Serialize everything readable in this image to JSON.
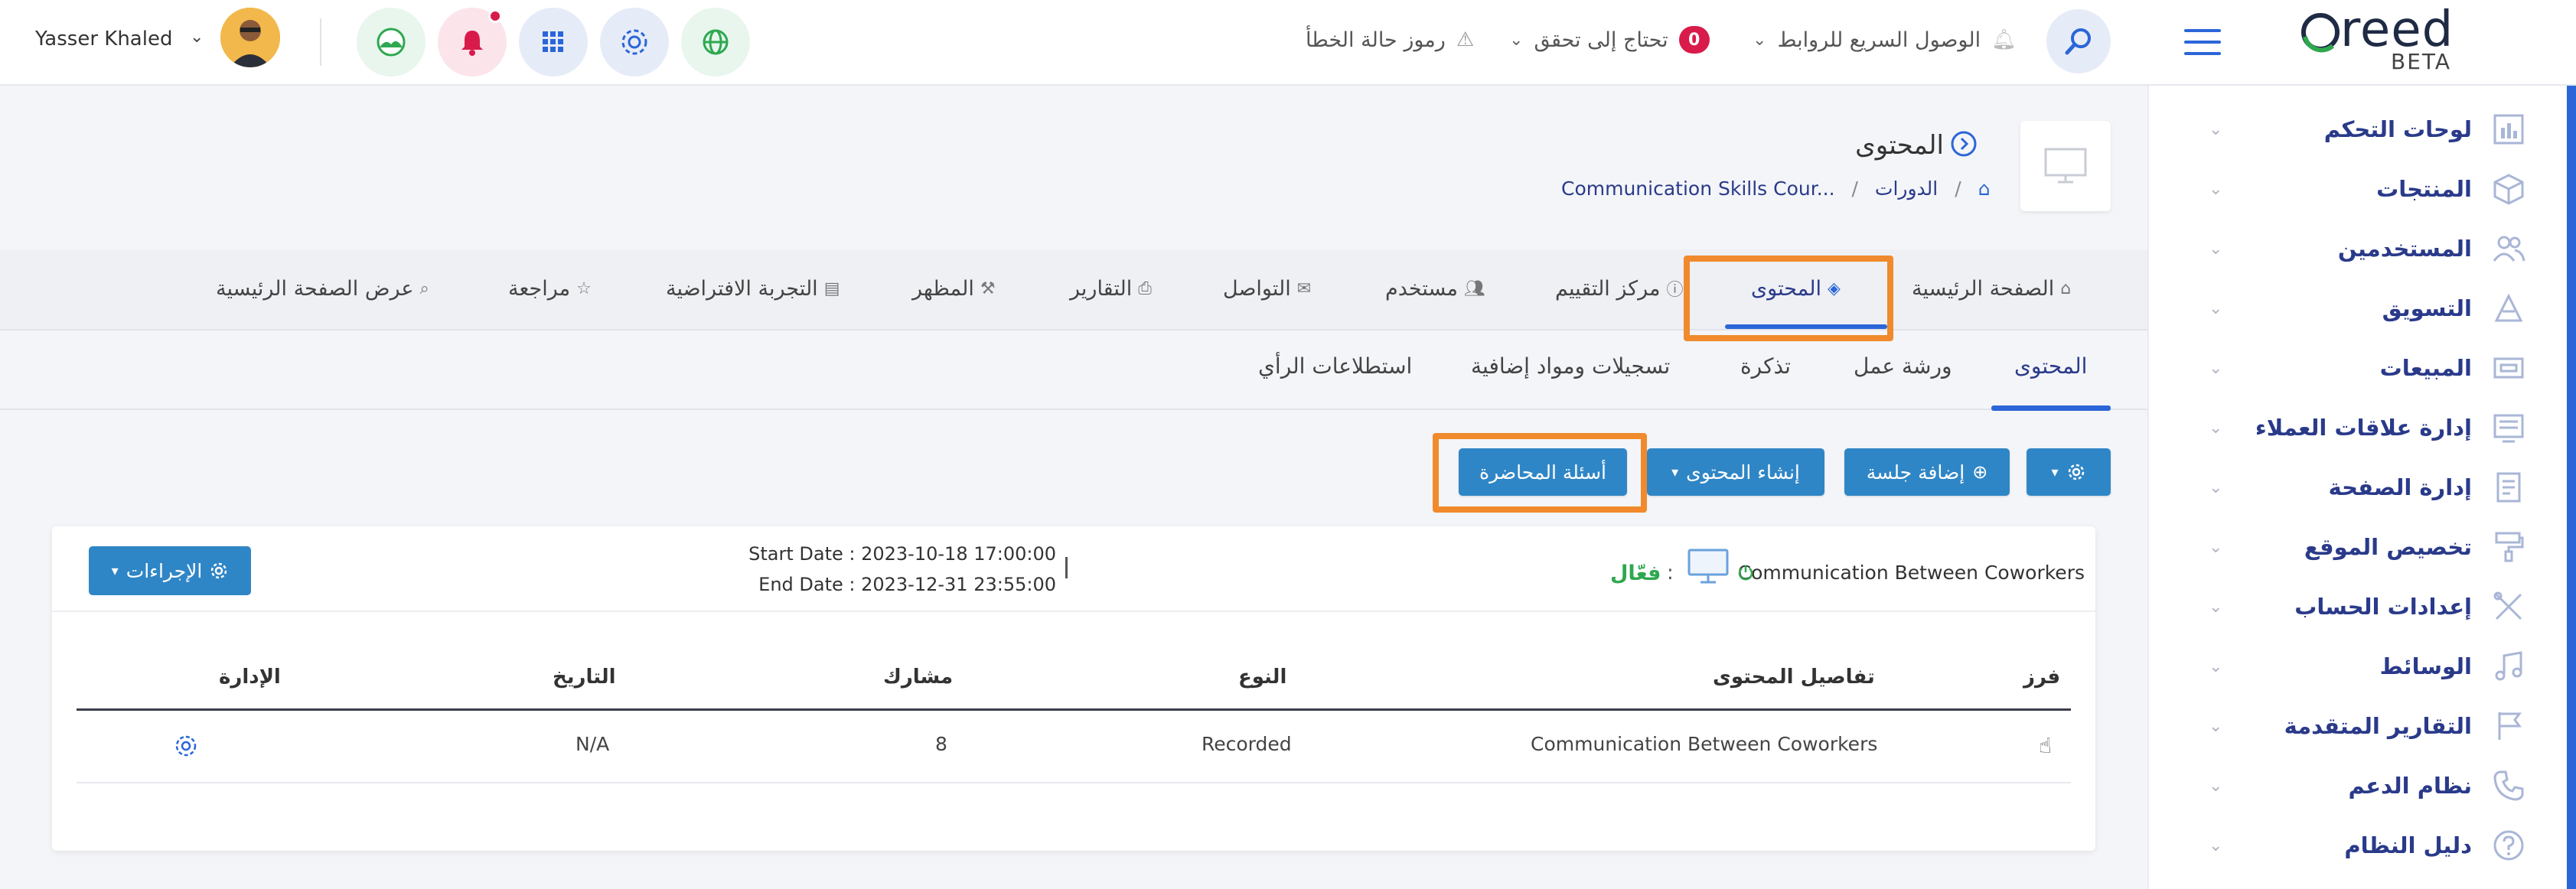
{
  "topbar": {
    "logo_text": "reed",
    "logo_sub": "BETA",
    "quick_links_label": "الوصول السريع للروابط",
    "needs_check_label": "تحتاج إلى تحقق",
    "needs_check_count": "0",
    "error_codes_label": "رموز حالة الخطأ",
    "user_name": "Yasser Khaled"
  },
  "sidebar": {
    "items": [
      {
        "label": "لوحات التحكم",
        "icon": "dashboard-icon"
      },
      {
        "label": "المنتجات",
        "icon": "box-icon"
      },
      {
        "label": "المستخدمين",
        "icon": "users-icon"
      },
      {
        "label": "التسويق",
        "icon": "marketing-icon"
      },
      {
        "label": "المبيعات",
        "icon": "sales-icon"
      },
      {
        "label": "إدارة علاقات العملاء",
        "icon": "crm-icon"
      },
      {
        "label": "إدارة الصفحة",
        "icon": "page-icon"
      },
      {
        "label": "تخصيص الموقع",
        "icon": "paint-roller-icon"
      },
      {
        "label": "إعدادات الحساب",
        "icon": "tools-icon"
      },
      {
        "label": "الوسائط",
        "icon": "music-icon"
      },
      {
        "label": "التقارير المتقدمة",
        "icon": "flag-icon"
      },
      {
        "label": "نظام الدعم",
        "icon": "phone-icon"
      },
      {
        "label": "دليل النظام",
        "icon": "help-icon"
      }
    ]
  },
  "page": {
    "title": "المحتوى",
    "breadcrumb_courses": "الدورات",
    "breadcrumb_current": "Communication Skills Cour..."
  },
  "tabs1": [
    {
      "label": "الصفحة الرئيسية"
    },
    {
      "label": "المحتوى"
    },
    {
      "label": "مركز التقييم"
    },
    {
      "label": "مستخدم"
    },
    {
      "label": "التواصل"
    },
    {
      "label": "التقارير"
    },
    {
      "label": "المظهر"
    },
    {
      "label": "التجربة الافتراضية"
    },
    {
      "label": "مراجعة"
    },
    {
      "label": "عرض الصفحة الرئيسية"
    }
  ],
  "tabs2": [
    {
      "label": "المحتوى"
    },
    {
      "label": "ورشة عمل"
    },
    {
      "label": "تذكرة"
    },
    {
      "label": "تسجيلات ومواد إضافية"
    },
    {
      "label": "استطلاعات الرأي"
    }
  ],
  "toolbar": {
    "add_session": "إضافة جلسة",
    "create_content": "إنشاء المحتوى",
    "lecture_questions": "أسئلة المحاضرة"
  },
  "card": {
    "title": "Communication Between Coworkers",
    "status": "فعّال",
    "start_date": "Start Date : 2023-10-18 17:00:00",
    "end_date": "End Date : 2023-12-31 23:55:00",
    "actions_label": "الإجراءات"
  },
  "table": {
    "headers": {
      "sort": "فرز",
      "details": "تفاصيل المحتوى",
      "type": "النوع",
      "participant": "مشارك",
      "date": "التاريخ",
      "manage": "الإدارة"
    },
    "rows": [
      {
        "details": "Communication Between Coworkers",
        "type": "Recorded",
        "participant": "8",
        "date": "N/A"
      }
    ]
  },
  "colors": {
    "primary": "#2b66d8",
    "button": "#2f86c6",
    "highlight": "#f08a2c",
    "active_status": "#2ea84f",
    "badge": "#d81b4a"
  }
}
